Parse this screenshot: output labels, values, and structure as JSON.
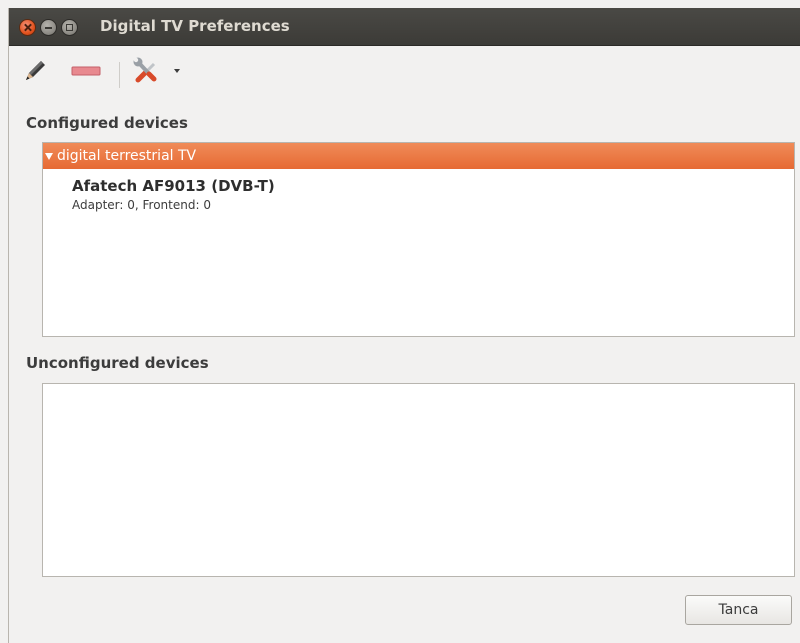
{
  "window": {
    "title": "Digital TV Preferences"
  },
  "toolbar": {
    "items": [
      {
        "name": "edit-icon"
      },
      {
        "name": "remove-icon"
      },
      {
        "name": "preferences-tools-icon"
      },
      {
        "name": "chevron-down-icon"
      }
    ]
  },
  "configured": {
    "heading": "Configured devices",
    "category": "digital terrestrial TV",
    "devices": [
      {
        "name": "Afatech AF9013 (DVB-T)",
        "details": "Adapter: 0, Frontend: 0"
      }
    ]
  },
  "unconfigured": {
    "heading": "Unconfigured devices"
  },
  "footer": {
    "close_label": "Tanca"
  },
  "colors": {
    "accent": "#e8713d",
    "titlebar": "#3c3b37"
  }
}
